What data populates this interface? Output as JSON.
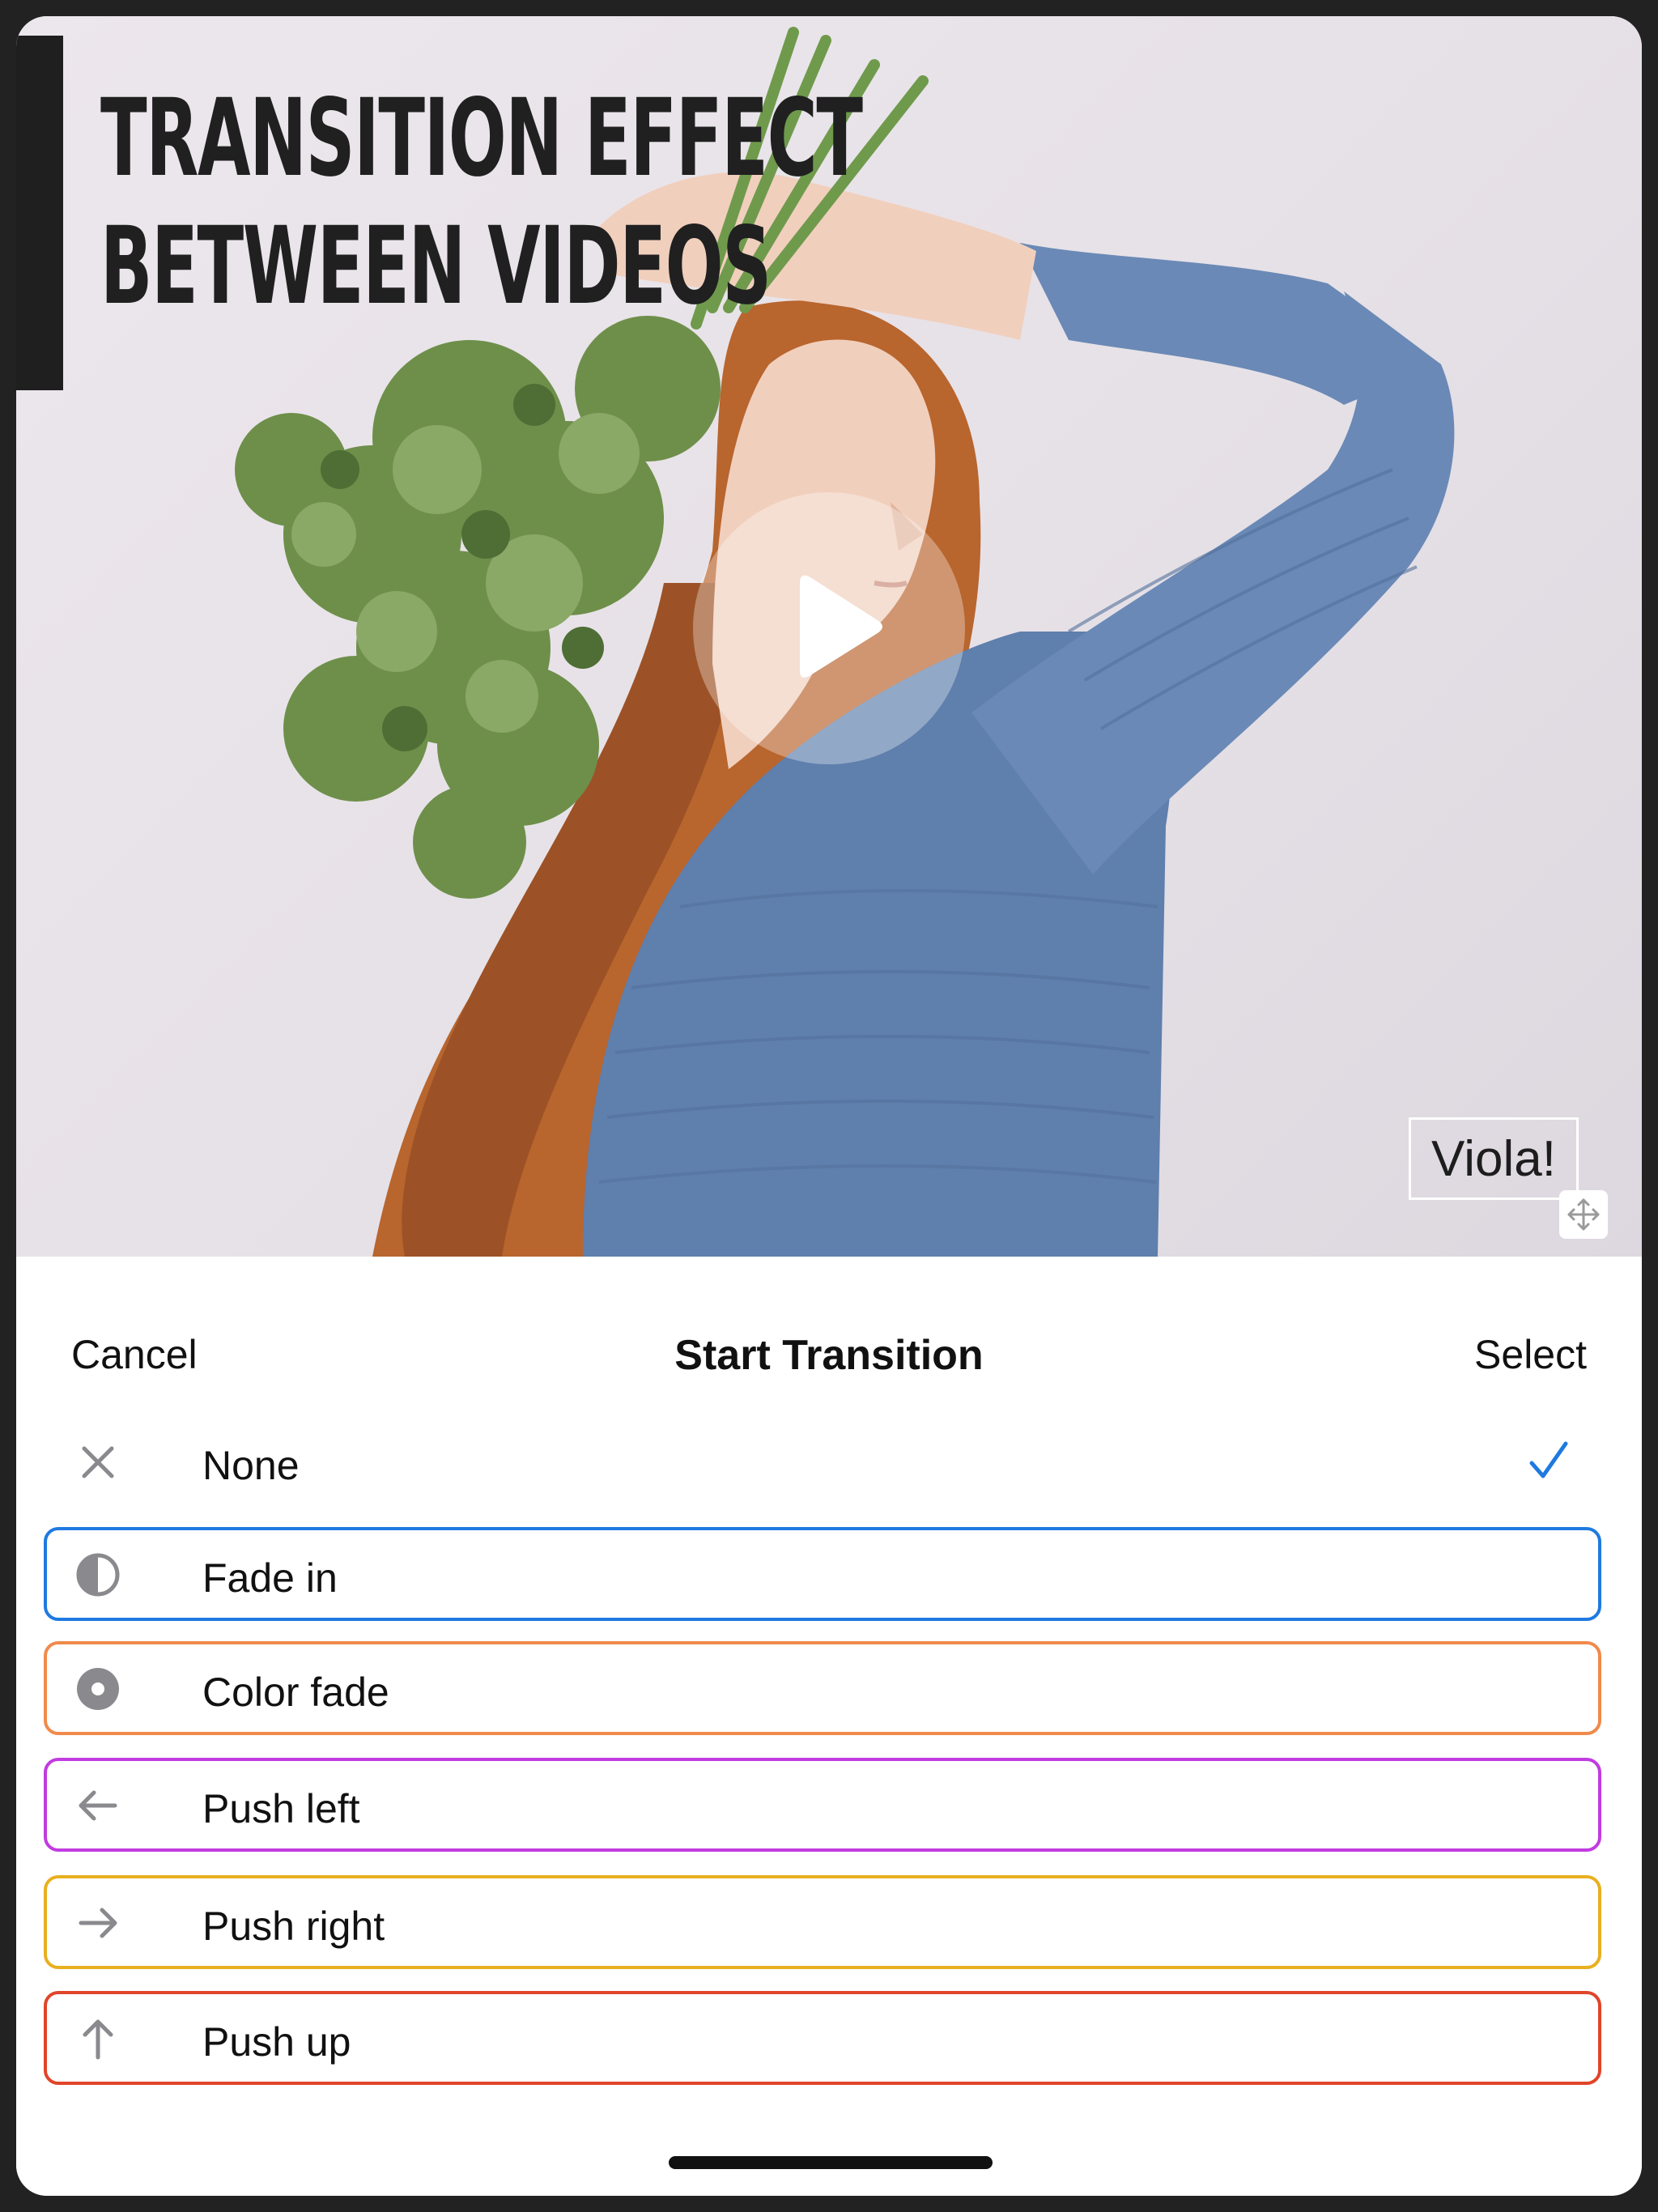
{
  "preview": {
    "title_line1": "Transition effect",
    "title_line2": "between videos",
    "caption": "Viola!"
  },
  "sheet": {
    "cancel_label": "Cancel",
    "title": "Start Transition",
    "select_label": "Select"
  },
  "options": [
    {
      "label": "None",
      "icon": "close-icon",
      "selected": true,
      "border_color": ""
    },
    {
      "label": "Fade in",
      "icon": "half-circle-icon",
      "selected": false,
      "border_color": "#1f7ae0"
    },
    {
      "label": "Color fade",
      "icon": "record-circle-icon",
      "selected": false,
      "border_color": "#f08a4b"
    },
    {
      "label": "Push left",
      "icon": "arrow-left-icon",
      "selected": false,
      "border_color": "#c13ce0"
    },
    {
      "label": "Push right",
      "icon": "arrow-right-icon",
      "selected": false,
      "border_color": "#e8b020"
    },
    {
      "label": "Push up",
      "icon": "arrow-up-icon",
      "selected": false,
      "border_color": "#e0452a"
    }
  ],
  "colors": {
    "accent": "#1f7ae0",
    "icon_gray": "#8a8a8e"
  }
}
